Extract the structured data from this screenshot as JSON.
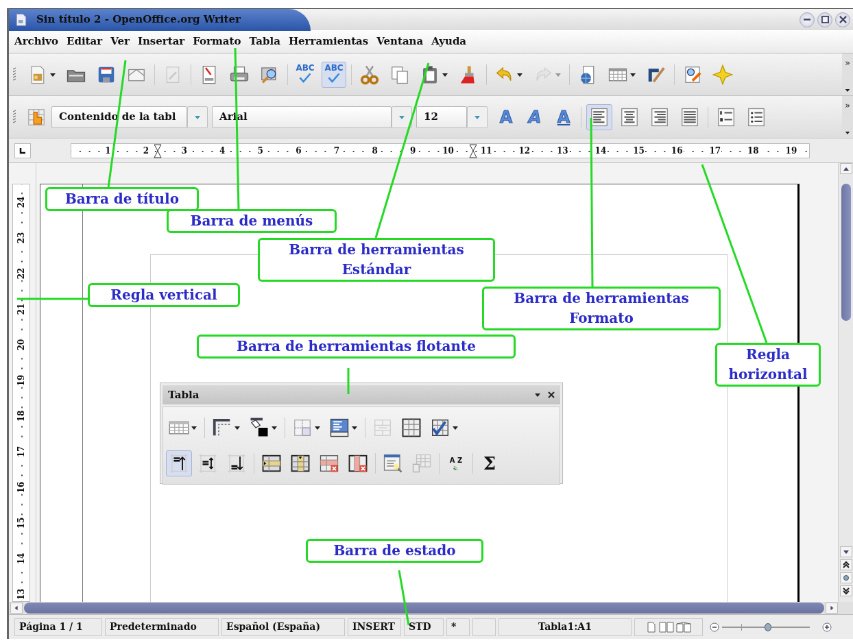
{
  "window": {
    "title": "Sin título 2 - OpenOffice.org Writer"
  },
  "menu": [
    {
      "label": "Archivo"
    },
    {
      "label": "Editar"
    },
    {
      "label": "Ver"
    },
    {
      "label": "Insertar"
    },
    {
      "label": "Formato"
    },
    {
      "label": "Tabla"
    },
    {
      "label": "Herramientas"
    },
    {
      "label": "Ventana"
    },
    {
      "label": "Ayuda"
    }
  ],
  "standard_toolbar": {
    "buttons": [
      {
        "pressed": false,
        "disabled": false,
        "dropdown": true
      },
      {
        "pressed": false,
        "disabled": false,
        "dropdown": false
      },
      {
        "pressed": false,
        "disabled": false,
        "dropdown": false
      },
      {
        "pressed": false,
        "disabled": false,
        "dropdown": false
      },
      {
        "pressed": false,
        "disabled": true,
        "dropdown": false
      },
      {
        "pressed": false,
        "disabled": false,
        "dropdown": false
      },
      {
        "pressed": false,
        "disabled": false,
        "dropdown": false
      },
      {
        "pressed": false,
        "disabled": false,
        "dropdown": false
      },
      {
        "pressed": false,
        "disabled": false,
        "dropdown": false,
        "glyph": "ABC"
      },
      {
        "pressed": true,
        "disabled": false,
        "dropdown": false,
        "glyph": "ABC"
      },
      {
        "pressed": false,
        "disabled": false,
        "dropdown": false
      },
      {
        "pressed": false,
        "disabled": false,
        "dropdown": false
      },
      {
        "pressed": false,
        "disabled": false,
        "dropdown": true
      },
      {
        "pressed": false,
        "disabled": false,
        "dropdown": false
      },
      {
        "pressed": false,
        "disabled": false,
        "dropdown": true
      },
      {
        "pressed": false,
        "disabled": true,
        "dropdown": true
      },
      {
        "pressed": false,
        "disabled": false,
        "dropdown": false
      },
      {
        "pressed": false,
        "disabled": false,
        "dropdown": true
      },
      {
        "pressed": false,
        "disabled": false,
        "dropdown": false
      },
      {
        "pressed": false,
        "disabled": false,
        "dropdown": false
      },
      {
        "pressed": false,
        "disabled": false,
        "dropdown": false
      }
    ],
    "overflow": "»"
  },
  "formatting_toolbar": {
    "paragraph_style": "Contenido de la tabl",
    "font_name": "Arial",
    "font_size": "12",
    "buttons": [
      {
        "pressed": false,
        "disabled": false
      },
      {
        "pressed": false,
        "disabled": false,
        "glyph": "A"
      },
      {
        "pressed": false,
        "disabled": false,
        "glyph": "A"
      },
      {
        "pressed": false,
        "disabled": false,
        "glyph": "A"
      },
      {
        "pressed": true,
        "disabled": false
      },
      {
        "pressed": false,
        "disabled": false
      },
      {
        "pressed": false,
        "disabled": false
      },
      {
        "pressed": false,
        "disabled": false
      },
      {
        "pressed": false,
        "disabled": false
      },
      {
        "pressed": false,
        "disabled": false
      }
    ],
    "overflow": "»"
  },
  "ruler": {
    "horizontal": [
      "1",
      "2",
      "3",
      "4",
      "5",
      "6",
      "7",
      "8",
      "9",
      "10",
      "11",
      "12",
      "13",
      "14",
      "15",
      "16",
      "17",
      "18",
      "19"
    ],
    "vertical": [
      "24",
      "23",
      "22",
      "21",
      "20",
      "19",
      "18",
      "17",
      "16",
      "15",
      "14",
      "13"
    ]
  },
  "floating_toolbar": {
    "title": "Tabla",
    "rows": [
      [
        {
          "pressed": false,
          "disabled": false,
          "dropdown": true
        },
        {
          "pressed": false,
          "disabled": false,
          "dropdown": true
        },
        {
          "pressed": false,
          "disabled": false,
          "dropdown": true
        },
        {
          "pressed": false,
          "disabled": false,
          "dropdown": true
        },
        {
          "pressed": false,
          "disabled": false,
          "dropdown": true
        },
        {
          "pressed": false,
          "disabled": true,
          "dropdown": false
        },
        {
          "pressed": false,
          "disabled": false,
          "dropdown": false
        },
        {
          "pressed": false,
          "disabled": false,
          "dropdown": true
        }
      ],
      [
        {
          "pressed": true,
          "disabled": false,
          "dropdown": false
        },
        {
          "pressed": false,
          "disabled": false,
          "dropdown": false
        },
        {
          "pressed": false,
          "disabled": false,
          "dropdown": false
        },
        {
          "pressed": false,
          "disabled": false,
          "dropdown": false
        },
        {
          "pressed": false,
          "disabled": false,
          "dropdown": false
        },
        {
          "pressed": false,
          "disabled": false,
          "dropdown": false
        },
        {
          "pressed": false,
          "disabled": false,
          "dropdown": false
        },
        {
          "pressed": false,
          "disabled": false,
          "dropdown": false
        },
        {
          "pressed": false,
          "disabled": true,
          "dropdown": false
        },
        {
          "pressed": false,
          "disabled": false,
          "dropdown": false,
          "glyph": "A Z"
        },
        {
          "pressed": false,
          "disabled": false,
          "dropdown": false,
          "glyph": "Σ"
        }
      ]
    ]
  },
  "status_bar": {
    "page": "Página 1 / 1",
    "page_style": "Predeterminado",
    "language": "Español (España)",
    "insert_mode": "INSERT",
    "selection_mode": "STD",
    "modified": "*",
    "cell": "Tabla1:A1",
    "zoom": {
      "level": 0.52
    }
  },
  "callouts": [
    {
      "lines": [
        "Barra de título"
      ]
    },
    {
      "lines": [
        "Barra de menús"
      ]
    },
    {
      "lines": [
        "Barra de herramientas",
        "Estándar"
      ]
    },
    {
      "lines": [
        "Regla vertical"
      ]
    },
    {
      "lines": [
        "Barra de herramientas",
        "Formato"
      ]
    },
    {
      "lines": [
        "Barra de herramientas flotante"
      ]
    },
    {
      "lines": [
        "Regla",
        "horizontal"
      ]
    },
    {
      "lines": [
        "Barra de estado"
      ]
    }
  ]
}
